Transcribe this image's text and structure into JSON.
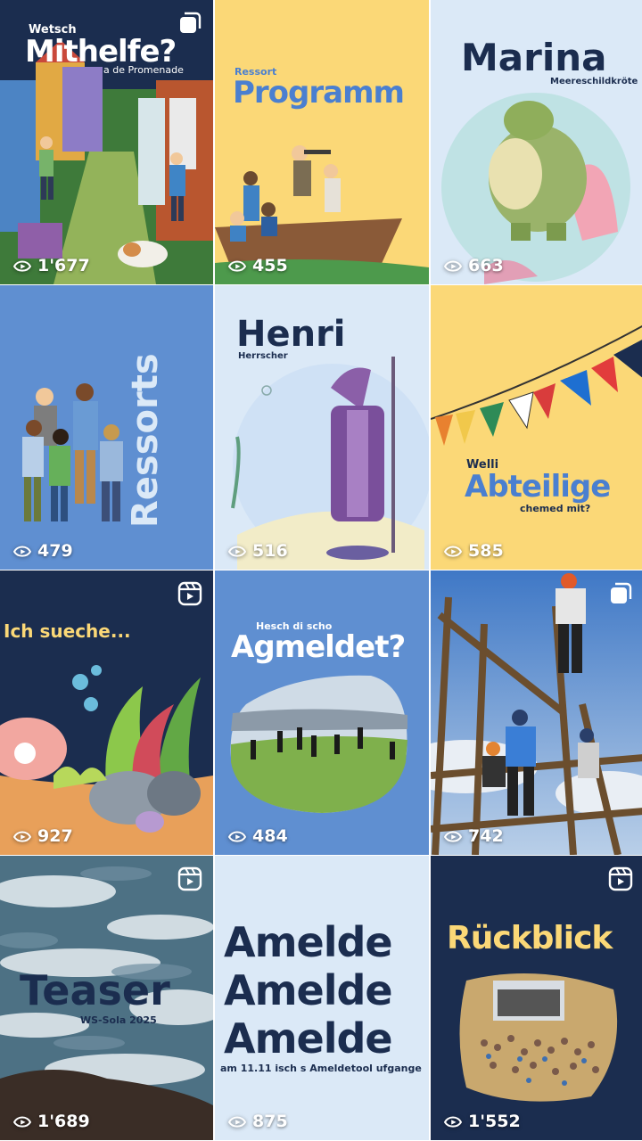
{
  "colors": {
    "navy": "#1b2d4f",
    "yellow": "#fbd877",
    "light_blue": "#dbe9f7",
    "mid_blue": "#5f8fd1",
    "text_blue": "#4a7fd0",
    "white": "#ffffff"
  },
  "icons": {
    "views": "eye-play-icon",
    "carousel": "multiple-posts-icon",
    "reel": "reel-icon"
  },
  "posts": [
    {
      "title_small": "Wetsch",
      "title": "Mithelfe?",
      "subtitle": "a de Promenade",
      "views": "1'677",
      "badge": "carousel"
    },
    {
      "title_small": "Ressort",
      "title": "Programm",
      "views": "455"
    },
    {
      "title": "Marina",
      "subtitle": "Meereschildkröte",
      "views": "663"
    },
    {
      "title": "Ressorts",
      "views": "479"
    },
    {
      "title": "Henri",
      "subtitle": "Herrscher",
      "views": "516"
    },
    {
      "title_small": "Welli",
      "title": "Abteilige",
      "subtitle": "chemed mit?",
      "views": "585"
    },
    {
      "title": "Ich sueche...",
      "views": "927",
      "badge": "reel"
    },
    {
      "title_small": "Hesch di scho",
      "title": "Agmeldet?",
      "views": "484"
    },
    {
      "views": "742",
      "badge": "carousel"
    },
    {
      "title": "Teaser",
      "subtitle": "WS-Sola 2025",
      "views": "1'689",
      "badge": "reel"
    },
    {
      "title_lines": [
        "Amelde",
        "Amelde",
        "Amelde"
      ],
      "subtitle": "am 11.11 isch s Ameldetool ufgange",
      "views": "875"
    },
    {
      "title": "Rückblick",
      "views": "1'552",
      "badge": "reel"
    }
  ]
}
